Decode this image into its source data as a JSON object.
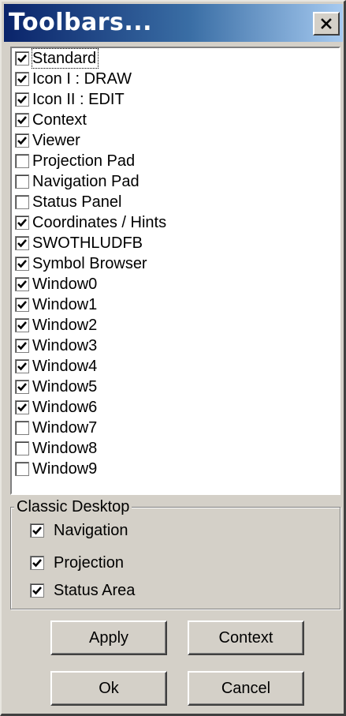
{
  "window": {
    "title": "Toolbars...",
    "close_icon": "close-icon"
  },
  "toolbars": [
    {
      "label": "Standard",
      "checked": true
    },
    {
      "label": "Icon I : DRAW",
      "checked": true
    },
    {
      "label": "Icon II : EDIT",
      "checked": true
    },
    {
      "label": "Context",
      "checked": true
    },
    {
      "label": "Viewer",
      "checked": true
    },
    {
      "label": "Projection Pad",
      "checked": false
    },
    {
      "label": "Navigation Pad",
      "checked": false
    },
    {
      "label": "Status Panel",
      "checked": false
    },
    {
      "label": "Coordinates / Hints",
      "checked": true
    },
    {
      "label": "SWOTHLUDFB",
      "checked": true
    },
    {
      "label": "Symbol Browser",
      "checked": true
    },
    {
      "label": "Window0",
      "checked": true
    },
    {
      "label": "Window1",
      "checked": true
    },
    {
      "label": "Window2",
      "checked": true
    },
    {
      "label": "Window3",
      "checked": true
    },
    {
      "label": "Window4",
      "checked": true
    },
    {
      "label": "Window5",
      "checked": true
    },
    {
      "label": "Window6",
      "checked": true
    },
    {
      "label": "Window7",
      "checked": false
    },
    {
      "label": "Window8",
      "checked": false
    },
    {
      "label": "Window9",
      "checked": false
    }
  ],
  "classic_desktop": {
    "title": "Classic Desktop",
    "options": [
      {
        "label": "Navigation",
        "checked": true
      },
      {
        "label": "Projection",
        "checked": true
      },
      {
        "label": "Status Area",
        "checked": true
      }
    ]
  },
  "buttons": {
    "apply": "Apply",
    "context": "Context",
    "ok": "Ok",
    "cancel": "Cancel"
  }
}
